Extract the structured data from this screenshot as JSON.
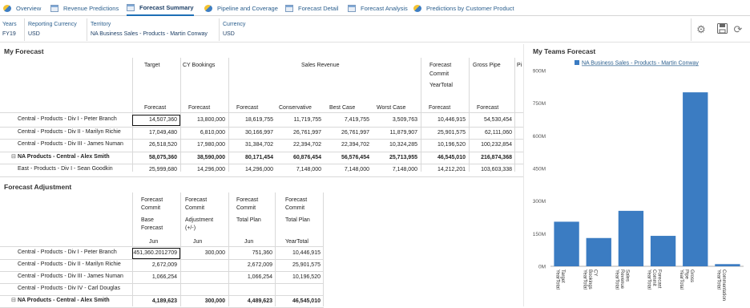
{
  "tabs": [
    {
      "label": "Overview",
      "icon": "chart-icon"
    },
    {
      "label": "Revenue Predictions",
      "icon": "form-icon"
    },
    {
      "label": "Forecast Summary",
      "icon": "form-icon",
      "active": true
    },
    {
      "label": "Pipeline and Coverage",
      "icon": "chart-icon"
    },
    {
      "label": "Forecast Detail",
      "icon": "form-icon"
    },
    {
      "label": "Forecast Analysis",
      "icon": "form-icon"
    },
    {
      "label": "Predictions by Customer Product",
      "icon": "chart-icon"
    }
  ],
  "pov": {
    "years_label": "Years",
    "years_value": "FY19",
    "reporting_currency_label": "Reporting Currency",
    "reporting_currency_value": "USD",
    "territory_label": "Territory",
    "territory_value": "NA Business Sales - Products - Martin Conway",
    "currency_label": "Currency",
    "currency_value": "USD"
  },
  "my_forecast": {
    "title": "My Forecast",
    "header_row1": [
      "Target",
      "CY Bookings",
      "Sales Revenue",
      "Forecast Commit",
      "Gross Pipe",
      "Pi"
    ],
    "header_yeartotal": "YearTotal",
    "header_row2": [
      "Forecast",
      "Forecast",
      "Forecast",
      "Conservative",
      "Best Case",
      "Worst Case",
      "Forecast",
      "Forecast"
    ],
    "rows": [
      {
        "label": "Central - Products - Div I - Peter Branch",
        "values": [
          "14,507,360",
          "13,800,000",
          "18,619,755",
          "11,719,755",
          "7,419,755",
          "3,509,763",
          "10,446,915",
          "54,530,454"
        ]
      },
      {
        "label": "Central - Products - Div II - Marilyn Richie",
        "values": [
          "17,049,480",
          "6,810,000",
          "30,166,997",
          "26,761,997",
          "26,761,997",
          "11,879,907",
          "25,901,575",
          "62,111,060"
        ]
      },
      {
        "label": "Central - Products - Div III - James Numan",
        "values": [
          "26,518,520",
          "17,980,000",
          "31,384,702",
          "22,394,702",
          "22,394,702",
          "10,324,285",
          "10,196,520",
          "100,232,854"
        ]
      },
      {
        "label": "NA Products - Central - Alex Smith",
        "values": [
          "58,075,360",
          "38,590,000",
          "80,171,454",
          "60,876,454",
          "56,576,454",
          "25,713,955",
          "46,545,010",
          "216,874,368"
        ],
        "bold": true,
        "expander": "⊟"
      },
      {
        "label": "East - Products - Div I - Sean Goodkin",
        "values": [
          "25,999,680",
          "14,296,000",
          "14,296,000",
          "7,148,000",
          "7,148,000",
          "7,148,000",
          "14,212,201",
          "103,603,338"
        ]
      }
    ]
  },
  "forecast_adjustment": {
    "title": "Forecast Adjustment",
    "headers": [
      [
        "Forecast",
        "Commit",
        "Base",
        "Forecast"
      ],
      [
        "Forecast",
        "Commit",
        "Adjustment",
        "(+/-)"
      ],
      [
        "Forecast",
        "Commit",
        "Total Plan"
      ],
      [
        "Forecast",
        "Commit",
        "Total Plan"
      ]
    ],
    "periods": [
      "Jun",
      "Jun",
      "Jun",
      "YearTotal"
    ],
    "rows": [
      {
        "label": "Central - Products - Div I - Peter Branch",
        "values": [
          "451,360.2012709",
          "300,000",
          "751,360",
          "10,446,915"
        ]
      },
      {
        "label": "Central - Products - Div II - Marilyn Richie",
        "values": [
          "2,672,009",
          "",
          "2,672,009",
          "25,901,575"
        ]
      },
      {
        "label": "Central - Products - Div III - James Numan",
        "values": [
          "1,066,254",
          "",
          "1,066,254",
          "10,196,520"
        ]
      },
      {
        "label": "Central - Products - Div IV - Carl Douglas",
        "values": [
          "",
          "",
          "",
          ""
        ]
      },
      {
        "label": "NA Products - Central - Alex Smith",
        "values": [
          "4,189,623",
          "300,000",
          "4,489,623",
          "46,545,010"
        ],
        "bold": true,
        "expander": "⊟"
      }
    ]
  },
  "teams_chart": {
    "title": "My Teams Forecast",
    "chart_data": {
      "type": "bar",
      "legend": "NA Business Sales - Products - Martin Conway",
      "legend_position": "top-center",
      "categories": [
        "Target YearTotal",
        "CY Bookings YearTotal",
        "Sales Revenue YearTotal",
        "Forecast Commit YearTotal",
        "Gross Pipe YearTotal",
        "Commentation YearTotal"
      ],
      "values": [
        205,
        130,
        255,
        140,
        800,
        10
      ],
      "ylim": [
        0,
        900
      ],
      "yticks": [
        "0M",
        "150M",
        "300M",
        "450M",
        "600M",
        "750M",
        "900M"
      ],
      "color": "#3b7cc2"
    }
  }
}
